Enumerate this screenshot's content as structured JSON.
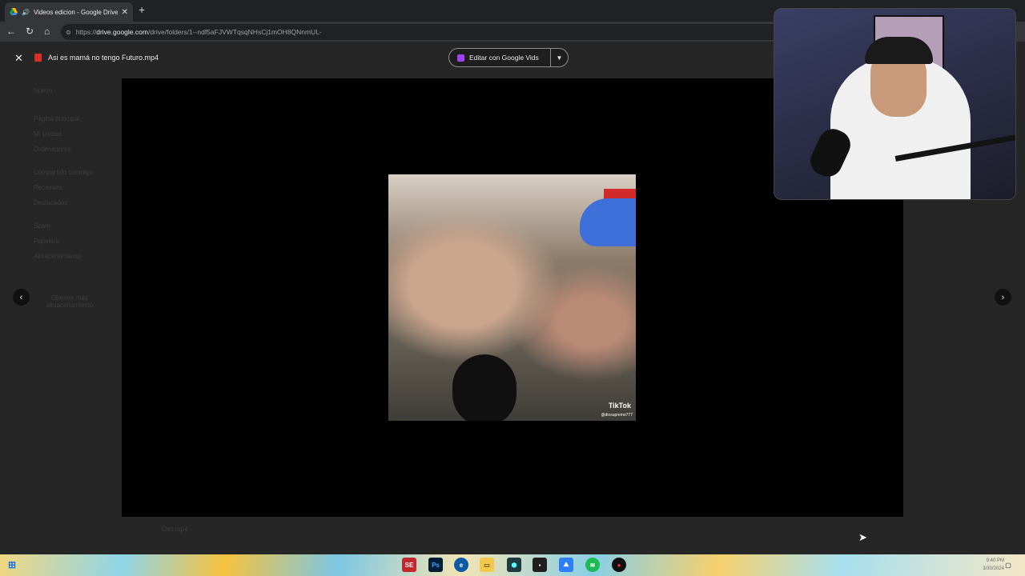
{
  "browser": {
    "tab_title": "Videos edicion - Google Drive",
    "url_host": "drive.google.com",
    "url_path": "/drive/folders/1--ndf5aFJVWTqsqNHsCj1mOH8QNnmUL-"
  },
  "drive_background": {
    "sidebar": [
      "Nuevo",
      "Página principal",
      "Mi unidad",
      "Ordenadores",
      "Compartido conmigo",
      "Recientes",
      "Destacados",
      "Spam",
      "Papelera",
      "Almacenamiento"
    ],
    "storage_text": "Obtener más almacenamiento",
    "bottom_file": "Ósó.mp4"
  },
  "viewer": {
    "file_name": "Asi es mamá no tengo Futuro.mp4",
    "edit_button": "Editar con Google Vids",
    "video_overlay": {
      "brand": "TikTok",
      "handle": "@diosupremo777"
    }
  },
  "taskbar": {
    "time": "9:40 PM",
    "date": "3/30/2024"
  },
  "icons": {
    "close": "close-icon",
    "prev": "chevron-left-icon",
    "next": "chevron-right-icon",
    "dropdown": "caret-down-icon"
  },
  "colors": {
    "video_file_red": "#d93025",
    "vids_purple": "#a142f4",
    "player_bg": "#000000"
  }
}
